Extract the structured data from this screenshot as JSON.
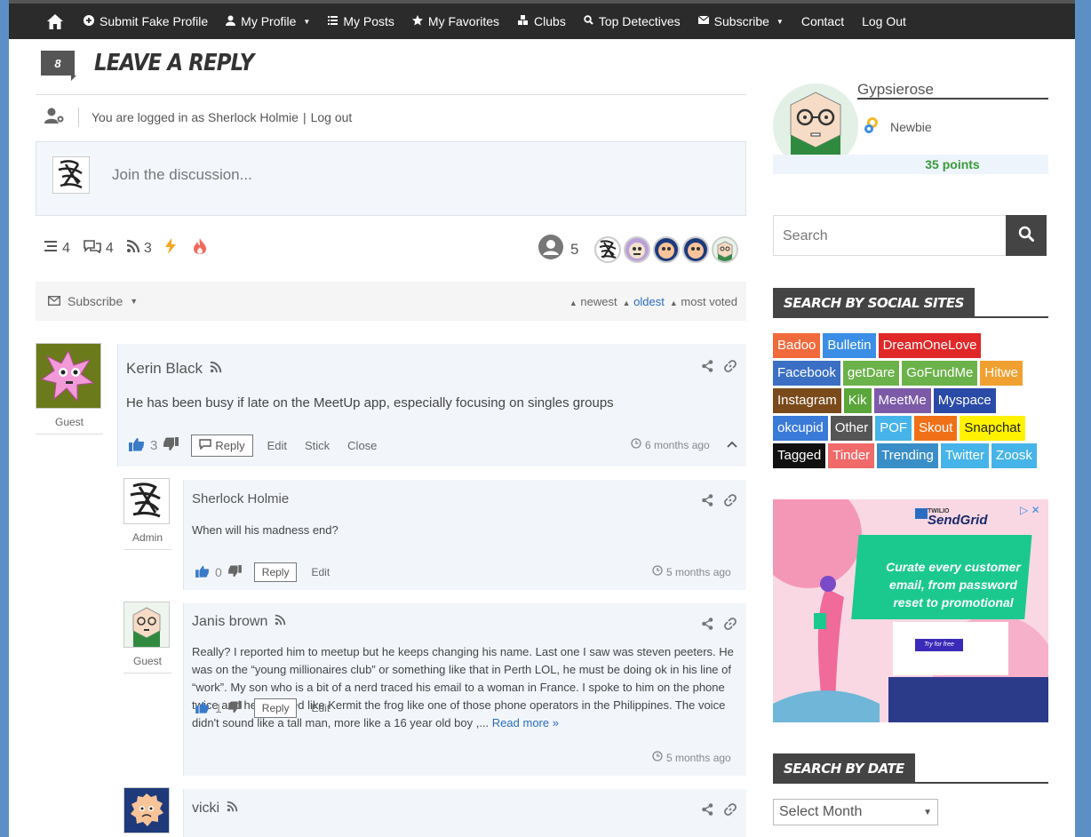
{
  "nav": {
    "items": [
      {
        "label": "Submit Fake Profile",
        "icon": "plus-circle-icon",
        "caret": false
      },
      {
        "label": "My Profile",
        "icon": "user-icon",
        "caret": true
      },
      {
        "label": "My Posts",
        "icon": "list-icon",
        "caret": false
      },
      {
        "label": "My Favorites",
        "icon": "star-icon",
        "caret": false
      },
      {
        "label": "Clubs",
        "icon": "cubes-icon",
        "caret": false
      },
      {
        "label": "Top Detectives",
        "icon": "search-icon",
        "caret": false
      },
      {
        "label": "Subscribe",
        "icon": "envelope-icon",
        "caret": true
      },
      {
        "label": "Contact",
        "icon": "",
        "caret": false
      },
      {
        "label": "Log Out",
        "icon": "",
        "caret": false
      }
    ]
  },
  "reply": {
    "count": "8",
    "title": "LEAVE A REPLY",
    "logged_in_text": "You are logged in as Sherlock Holmie",
    "separator": "|",
    "logout": "Log out",
    "placeholder": "Join the discussion..."
  },
  "stats": {
    "threads": "4",
    "replies": "4",
    "followers": "3",
    "participants": "5"
  },
  "subscribe_bar": {
    "subscribe": "Subscribe",
    "sort": [
      "newest",
      "oldest",
      "most voted"
    ],
    "active_sort": "oldest"
  },
  "comments": [
    {
      "author": "Kerin Black",
      "role": "Guest",
      "text": "He has been busy if late on the MeetUp app, especially focusing on singles groups",
      "votes": "3",
      "reply": "Reply",
      "actions": [
        "Edit",
        "Stick",
        "Close"
      ],
      "time": "6 months ago"
    },
    {
      "author": "Sherlock Holmie",
      "role": "Admin",
      "text": "When will his madness end?",
      "votes": "0",
      "reply": "Reply",
      "actions": [
        "Edit"
      ],
      "time": "5 months ago"
    },
    {
      "author": "Janis brown",
      "role": "Guest",
      "text": "Really? I reported him to meetup but he keeps changing his name. Last one I saw was steven peeters. He was on the “young millionaires club” or something like that in Perth LOL, he must be doing ok in his line of “work”. My son who is a bit of a nerd traced his email to a woman in France. I spoke to him on the phone twice and he sounded like Kermit the frog like one of those phone operators in the Philippines. The voice didn't sound like a tall man, more like a 16 year old boy ,...",
      "read_more": "Read more »",
      "votes": "1",
      "reply": "Reply",
      "actions": [
        "Edit"
      ],
      "time": "5 months ago"
    },
    {
      "author": "vicki",
      "role": "",
      "text": "",
      "votes": "",
      "reply": "",
      "actions": [],
      "time": ""
    }
  ],
  "sidebar": {
    "username": "Gypsierose",
    "rank": "Newbie",
    "points": "35 points",
    "search_placeholder": "Search",
    "social_title": "SEARCH BY SOCIAL SITES",
    "social_tags": [
      {
        "label": "Badoo",
        "color": "#f06a3c"
      },
      {
        "label": "Bulletin",
        "color": "#3a8ee6"
      },
      {
        "label": "DreamOneLove",
        "color": "#e02828"
      },
      {
        "label": "Facebook",
        "color": "#3b6fc4"
      },
      {
        "label": "getDare",
        "color": "#6cb24a"
      },
      {
        "label": "GoFundMe",
        "color": "#6cb24a"
      },
      {
        "label": "Hitwe",
        "color": "#f0a030"
      },
      {
        "label": "Instagram",
        "color": "#7a4a1a"
      },
      {
        "label": "Kik",
        "color": "#5aa63a"
      },
      {
        "label": "MeetMe",
        "color": "#7c5aa8"
      },
      {
        "label": "Myspace",
        "color": "#2a4aa8"
      },
      {
        "label": "okcupid",
        "color": "#3a7ad8"
      },
      {
        "label": "Other",
        "color": "#555555"
      },
      {
        "label": "POF",
        "color": "#46b4e8"
      },
      {
        "label": "Skout",
        "color": "#f07018"
      },
      {
        "label": "Snapchat",
        "color": "#fff200"
      },
      {
        "label": "Tagged",
        "color": "#111111"
      },
      {
        "label": "Tinder",
        "color": "#f06a6a"
      },
      {
        "label": "Trending",
        "color": "#3a8ec8"
      },
      {
        "label": "Twitter",
        "color": "#46b4e8"
      },
      {
        "label": "Zoosk",
        "color": "#46b4e8"
      }
    ],
    "ad": {
      "brand": "SendGrid",
      "brand_prefix": "TWILIO",
      "headline": "Curate every customer email, from password reset to promotional",
      "cta": "Try for free"
    },
    "date_title": "SEARCH BY DATE",
    "date_select": "Select Month"
  }
}
